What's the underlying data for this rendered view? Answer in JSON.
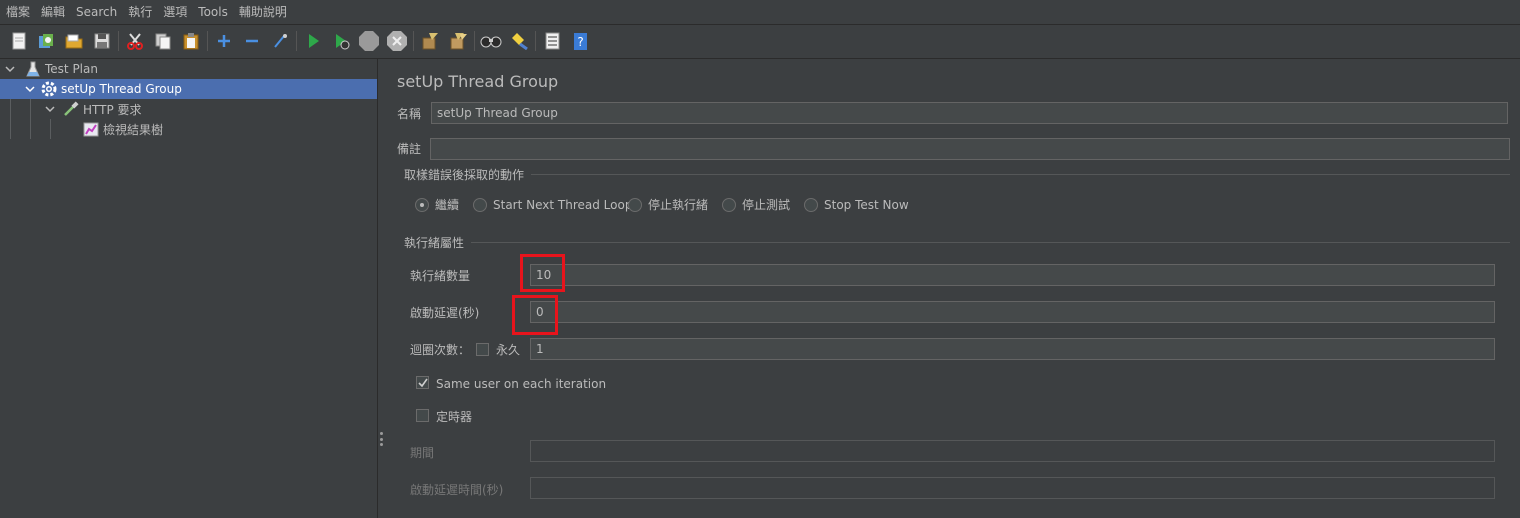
{
  "menu": [
    "檔案",
    "編輯",
    "Search",
    "執行",
    "選項",
    "Tools",
    "輔助說明"
  ],
  "toolbar": {
    "icons": [
      "new-icon",
      "templates-icon",
      "open-icon",
      "save-icon",
      "cut-icon",
      "copy-icon",
      "paste-icon",
      "expand-icon",
      "collapse-icon",
      "toggle-icon",
      "start-icon",
      "start-no-pause-icon",
      "stop-icon",
      "shutdown-icon",
      "clear-icon",
      "clear-all-icon",
      "search-icon",
      "reset-search-icon",
      "function-helper-icon",
      "help-icon"
    ]
  },
  "tree": {
    "test_plan": "Test Plan",
    "setup_group": "setUp Thread Group",
    "http_request": "HTTP 要求",
    "view_results": "檢視結果樹"
  },
  "panel": {
    "title": "setUp Thread Group",
    "name_label": "名稱",
    "name_value": "setUp Thread Group",
    "comment_label": "備註",
    "comment_value": "",
    "error_action_title": "取樣錯誤後採取的動作",
    "error_actions": [
      {
        "label": "繼續",
        "selected": true
      },
      {
        "label": "Start Next Thread Loop",
        "selected": false
      },
      {
        "label": "停止執行緒",
        "selected": false
      },
      {
        "label": "停止測試",
        "selected": false
      },
      {
        "label": "Stop Test Now",
        "selected": false
      }
    ],
    "thread_props_title": "執行緒屬性",
    "threads_label": "執行緒數量",
    "threads_value": "10",
    "rampup_label": "啟動延遲(秒)",
    "rampup_value": "0",
    "loop_label": "迴圈次數：",
    "forever_label": "永久",
    "forever_checked": false,
    "loop_value": "1",
    "same_user_label": "Same user on each iteration",
    "same_user_checked": true,
    "scheduler_label": "定時器",
    "scheduler_checked": false,
    "duration_label": "期間",
    "duration_value": "",
    "startup_delay_label": "啟動延遲時間(秒)",
    "startup_delay_value": ""
  },
  "colors": {
    "background": "#3c3f41",
    "selection": "#4b6eaf",
    "highlight": "#e8141c",
    "field": "#45494a"
  }
}
